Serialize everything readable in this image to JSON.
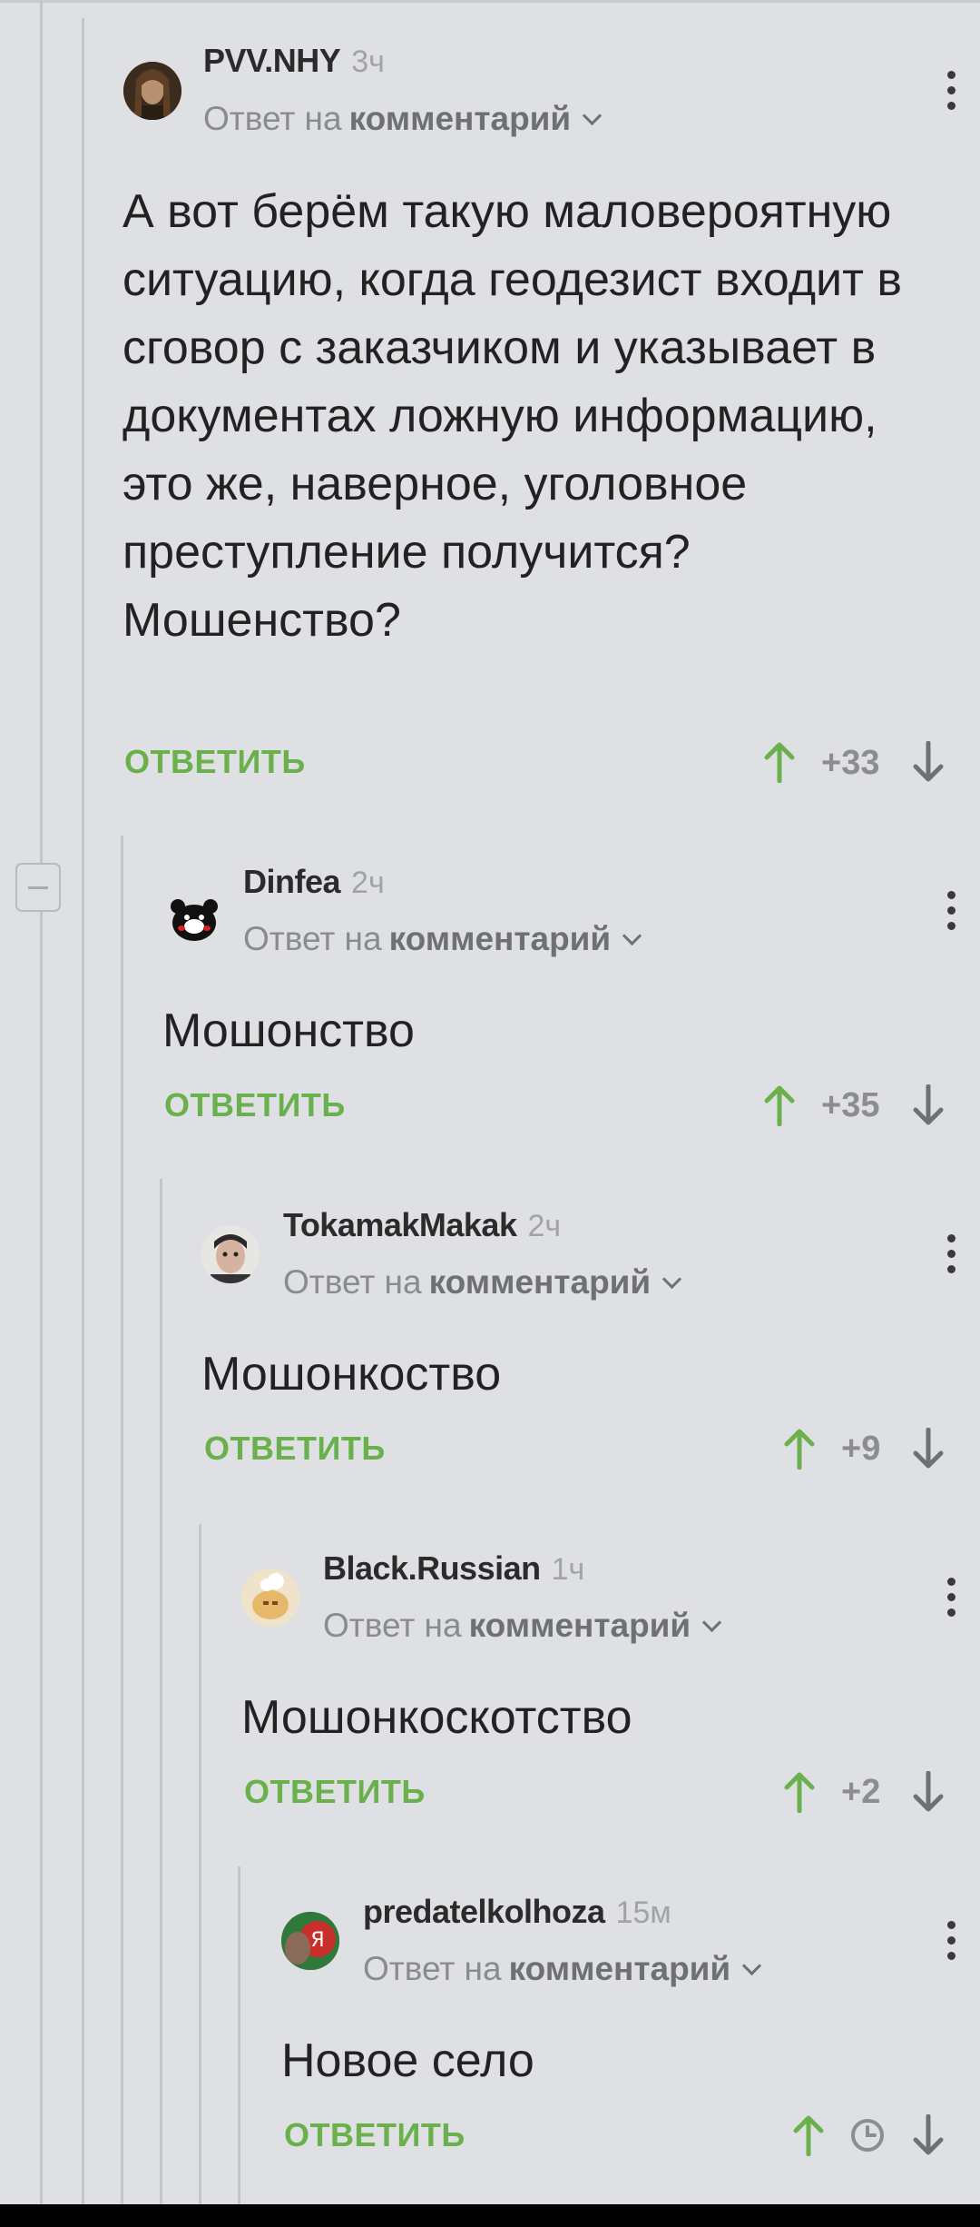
{
  "colors": {
    "background": "#dfe0e4",
    "accent_green": "#6ab04c",
    "text": "#222222",
    "muted": "#8a8b90"
  },
  "icons": {
    "menu": "kebab-icon",
    "upvote": "arrow-up-icon",
    "downvote": "arrow-down-icon",
    "chevron": "chevron-down-icon",
    "pending": "clock-icon",
    "collapse": "collapse-icon"
  },
  "labels": {
    "reply_to_prefix": "Ответ на",
    "reply_to_target": "комментарий",
    "reply_button": "ОТВЕТИТЬ"
  },
  "comments": [
    {
      "author": "PVV.NHY",
      "time": "3ч",
      "body": "А вот берём такую маловероятную ситуацию, когда геодезист входит в сговор с заказчиком и указывает в документах ложную информацию, это же, наверное, уголовное преступление получится? Мошенство?",
      "score": "+33"
    },
    {
      "author": "Dinfea",
      "time": "2ч",
      "body": "Мошонство",
      "score": "+35"
    },
    {
      "author": "TokamakMakak",
      "time": "2ч",
      "body": "Мошонкоство",
      "score": "+9"
    },
    {
      "author": "Black.Russian",
      "time": "1ч",
      "body": "Мошонкоскотство",
      "score": "+2"
    },
    {
      "author": "predatelkolhoza",
      "time": "15м",
      "body": "Новое село",
      "score": ""
    }
  ]
}
